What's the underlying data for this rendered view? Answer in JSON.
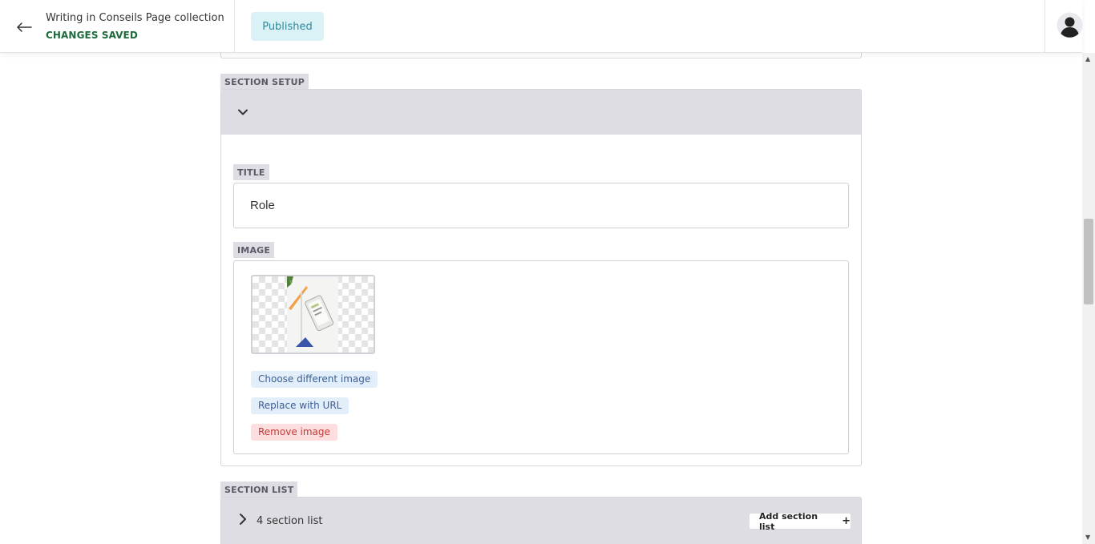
{
  "header": {
    "breadcrumb": "Writing in Conseils Page collection",
    "save_status": "CHANGES SAVED",
    "status_badge": "Published"
  },
  "section_setup": {
    "tag": "SECTION SETUP",
    "title_field": {
      "label": "TITLE",
      "value": "Role"
    },
    "image_field": {
      "label": "IMAGE",
      "choose_label": "Choose different image",
      "replace_label": "Replace with URL",
      "remove_label": "Remove image"
    }
  },
  "section_list": {
    "tag": "SECTION LIST",
    "count_label": "4 section list",
    "add_label": "Add section list"
  }
}
